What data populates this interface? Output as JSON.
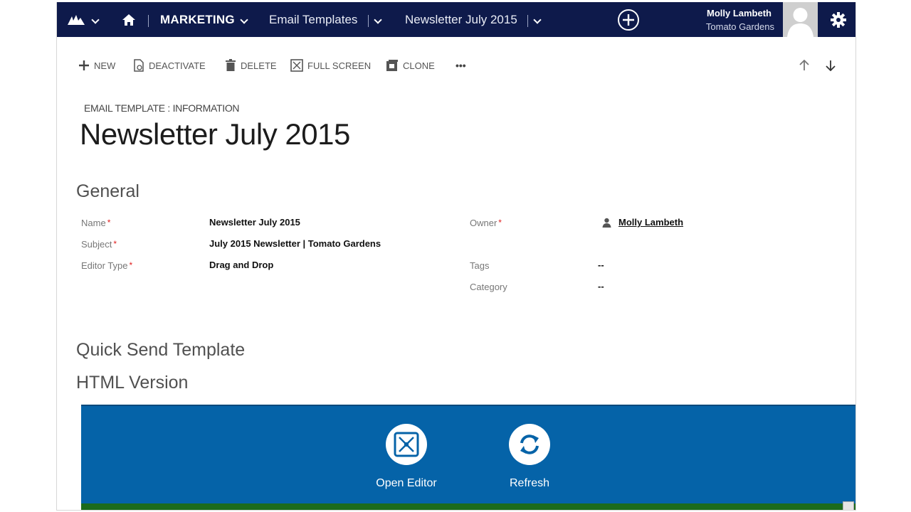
{
  "nav": {
    "module": "MARKETING",
    "entity": "Email Templates",
    "record": "Newsletter July 2015",
    "user_name": "Molly Lambeth",
    "user_org": "Tomato Gardens"
  },
  "toolbar": {
    "new": "NEW",
    "deactivate": "DEACTIVATE",
    "delete": "DELETE",
    "full_screen": "FULL SCREEN",
    "clone": "CLONE",
    "more": "•••"
  },
  "header": {
    "form_type": "EMAIL TEMPLATE : INFORMATION",
    "title": "Newsletter July 2015"
  },
  "general": {
    "heading": "General",
    "name_label": "Name",
    "name_value": "Newsletter July 2015",
    "subject_label": "Subject",
    "subject_value": "July 2015 Newsletter | Tomato Gardens",
    "editor_type_label": "Editor Type",
    "editor_type_value": "Drag and Drop",
    "owner_label": "Owner",
    "owner_value": "Molly Lambeth",
    "tags_label": "Tags",
    "tags_value": "--",
    "category_label": "Category",
    "category_value": "--",
    "required_marker": "*"
  },
  "sections": {
    "quick_send": "Quick Send Template",
    "html_version": "HTML Version"
  },
  "editor": {
    "open_editor": "Open Editor",
    "refresh": "Refresh"
  },
  "colors": {
    "navbar": "#0e1a4b",
    "editor_bg": "#0563a8",
    "editor_strip": "#1c6b1c",
    "required": "#e02020"
  },
  "icons": [
    "logo-icon",
    "home-icon",
    "chevron-down-icon",
    "add-circle-icon",
    "gear-icon",
    "plus-icon",
    "deactivate-icon",
    "trash-icon",
    "full-screen-icon",
    "clone-icon",
    "arrow-up-icon",
    "arrow-down-icon",
    "user-icon",
    "expand-icon",
    "refresh-icon"
  ]
}
